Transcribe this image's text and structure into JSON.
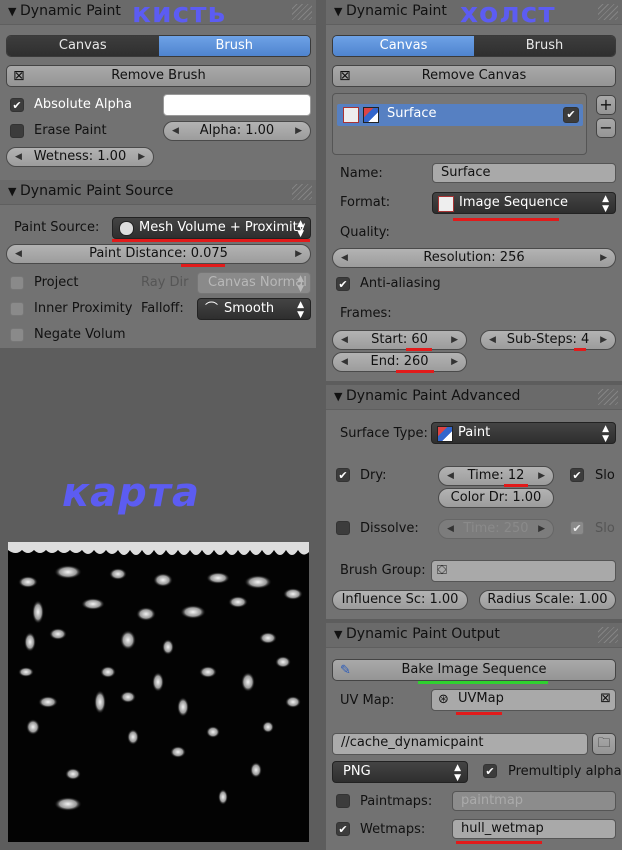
{
  "brush_panel": {
    "header": "Dynamic Paint",
    "annotation": "кисть",
    "tabs": [
      "Canvas",
      "Brush"
    ],
    "remove_label": "Remove Brush",
    "absolute_alpha": "Absolute Alpha",
    "erase_paint": "Erase Paint",
    "alpha": "Alpha: 1.00",
    "wetness": "Wetness: 1.00",
    "color": "#ffffff"
  },
  "source_panel": {
    "header": "Dynamic Paint Source",
    "paint_source_label": "Paint Source:",
    "paint_source_value": "Mesh Volume + Proximity",
    "paint_distance": "Paint Distance: 0.075",
    "project": "Project",
    "ray_dir": "Ray Dir",
    "ray_dir_value": "Canvas Normal",
    "inner_proximity": "Inner Proximity",
    "falloff_label": "Falloff:",
    "falloff_value": "Smooth",
    "negate_volume": "Negate Volum"
  },
  "map_annotation": "карта",
  "canvas_panel": {
    "header": "Dynamic Paint",
    "annotation": "холст",
    "tabs": [
      "Canvas",
      "Brush"
    ],
    "remove_label": "Remove Canvas",
    "surface_item": "Surface",
    "name_label": "Name:",
    "name_value": "Surface",
    "format_label": "Format:",
    "format_value": "Image Sequence",
    "quality_label": "Quality:",
    "resolution": "Resolution: 256",
    "anti_aliasing": "Anti-aliasing",
    "frames_label": "Frames:",
    "start": "Start: 60",
    "end": "End: 260",
    "substeps": "Sub-Steps: 4"
  },
  "advanced_panel": {
    "header": "Dynamic Paint Advanced",
    "surface_type_label": "Surface Type:",
    "surface_type_value": "Paint",
    "dry_label": "Dry:",
    "time": "Time: 12",
    "color_dry": "Color Dr: 1.00",
    "slow": "Slo",
    "dissolve_label": "Dissolve:",
    "dissolve_time": "Time: 250",
    "slow2": "Slo",
    "brush_group_label": "Brush Group:",
    "influence": "Influence Sc: 1.00",
    "radius": "Radius Scale: 1.00"
  },
  "output_panel": {
    "header": "Dynamic Paint Output",
    "bake_label": "Bake Image Sequence",
    "uv_label": "UV Map:",
    "uv_value": "UVMap",
    "path": "//cache_dynamicpaint",
    "file_format": "PNG",
    "premultiply": "Premultiply alpha",
    "paintmaps_label": "Paintmaps:",
    "paintmaps_value": "paintmap",
    "wetmaps_label": "Wetmaps:",
    "wetmaps_value": "hull_wetmap"
  }
}
